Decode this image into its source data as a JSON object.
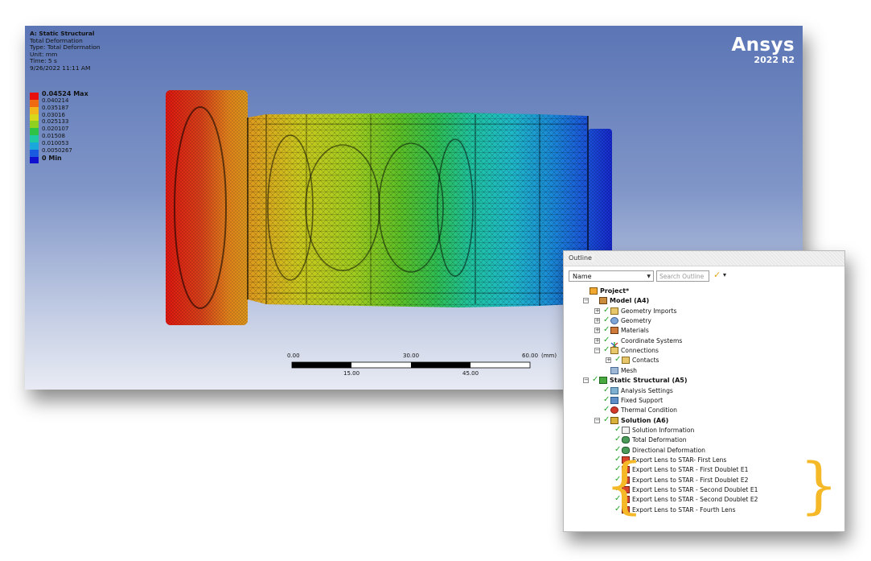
{
  "viewport": {
    "analysis_title": "A: Static Structural",
    "result_name": "Total Deformation",
    "result_type": "Type: Total Deformation",
    "unit": "Unit: mm",
    "time": "Time: 5 s",
    "timestamp": "9/26/2022 11:11 AM",
    "logo_brand": "Ansys",
    "logo_version": "2022 R2",
    "legend": [
      {
        "label": "0.04524 Max",
        "color": "#e8100c",
        "bold": true
      },
      {
        "label": "0.040214",
        "color": "#f06a12",
        "bold": false
      },
      {
        "label": "0.035187",
        "color": "#f2b51a",
        "bold": false
      },
      {
        "label": "0.03016",
        "color": "#d7d81c",
        "bold": false
      },
      {
        "label": "0.025133",
        "color": "#8fd021",
        "bold": false
      },
      {
        "label": "0.020107",
        "color": "#2fc345",
        "bold": false
      },
      {
        "label": "0.01508",
        "color": "#1fc9a3",
        "bold": false
      },
      {
        "label": "0.010053",
        "color": "#1aa7dc",
        "bold": false
      },
      {
        "label": "0.0050267",
        "color": "#1a5ae0",
        "bold": false
      },
      {
        "label": "0 Min",
        "color": "#1010d0",
        "bold": true
      }
    ],
    "scale_bar": {
      "top_labels": [
        "0.00",
        "30.00",
        "60.00"
      ],
      "bottom_labels": [
        "15.00",
        "45.00"
      ],
      "unit": "(mm)"
    }
  },
  "outline": {
    "title": "Outline",
    "filter_select": "Name",
    "search_placeholder": "Search Outline",
    "tree": [
      {
        "label": "Project*",
        "bold": true,
        "indent": 0,
        "expander": "",
        "check": false,
        "icon": "ic-project",
        "icon_name": "project-icon"
      },
      {
        "label": "Model (A4)",
        "bold": true,
        "indent": 1,
        "expander": "−",
        "check": false,
        "icon": "ic-model",
        "icon_name": "model-icon"
      },
      {
        "label": "Geometry Imports",
        "bold": false,
        "indent": 2,
        "expander": "+",
        "check": true,
        "icon": "ic-folder",
        "icon_name": "geometry-imports-icon"
      },
      {
        "label": "Geometry",
        "bold": false,
        "indent": 2,
        "expander": "+",
        "check": true,
        "icon": "ic-geom",
        "icon_name": "geometry-icon"
      },
      {
        "label": "Materials",
        "bold": false,
        "indent": 2,
        "expander": "+",
        "check": true,
        "icon": "ic-mat",
        "icon_name": "materials-icon"
      },
      {
        "label": "Coordinate Systems",
        "bold": false,
        "indent": 2,
        "expander": "+",
        "check": true,
        "icon": "ic-coord",
        "icon_name": "coordinate-systems-icon"
      },
      {
        "label": "Connections",
        "bold": false,
        "indent": 2,
        "expander": "−",
        "check": true,
        "icon": "ic-folder",
        "icon_name": "connections-icon"
      },
      {
        "label": "Contacts",
        "bold": false,
        "indent": 3,
        "expander": "+",
        "check": true,
        "icon": "ic-folder",
        "icon_name": "contacts-icon"
      },
      {
        "label": "Mesh",
        "bold": false,
        "indent": 2,
        "expander": "",
        "check": false,
        "icon": "ic-mesh",
        "icon_name": "mesh-icon"
      },
      {
        "label": "Static Structural (A5)",
        "bold": true,
        "indent": 1,
        "expander": "−",
        "check": true,
        "icon": "ic-static",
        "icon_name": "static-structural-icon"
      },
      {
        "label": "Analysis Settings",
        "bold": false,
        "indent": 2,
        "expander": "",
        "check": true,
        "icon": "ic-settings",
        "icon_name": "analysis-settings-icon"
      },
      {
        "label": "Fixed Support",
        "bold": false,
        "indent": 2,
        "expander": "",
        "check": true,
        "icon": "ic-support",
        "icon_name": "fixed-support-icon"
      },
      {
        "label": "Thermal Condition",
        "bold": false,
        "indent": 2,
        "expander": "",
        "check": true,
        "icon": "ic-thermal",
        "icon_name": "thermal-condition-icon"
      },
      {
        "label": "Solution (A6)",
        "bold": true,
        "indent": 2,
        "expander": "−",
        "check": true,
        "icon": "ic-solution",
        "icon_name": "solution-icon"
      },
      {
        "label": "Solution Information",
        "bold": false,
        "indent": 3,
        "expander": "",
        "check": true,
        "icon": "ic-info",
        "icon_name": "solution-information-icon"
      },
      {
        "label": "Total Deformation",
        "bold": false,
        "indent": 3,
        "expander": "",
        "check": true,
        "icon": "ic-deform",
        "icon_name": "total-deformation-icon"
      },
      {
        "label": "Directional Deformation",
        "bold": false,
        "indent": 3,
        "expander": "",
        "check": true,
        "icon": "ic-deform",
        "icon_name": "directional-deformation-icon"
      },
      {
        "label": "Export Lens to STAR- First Lens",
        "bold": false,
        "indent": 3,
        "expander": "",
        "check": true,
        "icon": "ic-py",
        "icon_name": "python-result-icon"
      },
      {
        "label": "Export Lens to STAR - First Doublet E1",
        "bold": false,
        "indent": 3,
        "expander": "",
        "check": true,
        "icon": "ic-py",
        "icon_name": "python-result-icon"
      },
      {
        "label": "Export Lens to STAR - First Doublet E2",
        "bold": false,
        "indent": 3,
        "expander": "",
        "check": true,
        "icon": "ic-py",
        "icon_name": "python-result-icon"
      },
      {
        "label": "Export Lens to STAR - Second Doublet E1",
        "bold": false,
        "indent": 3,
        "expander": "",
        "check": true,
        "icon": "ic-py",
        "icon_name": "python-result-icon"
      },
      {
        "label": "Export Lens to STAR - Second Doublet E2",
        "bold": false,
        "indent": 3,
        "expander": "",
        "check": true,
        "icon": "ic-py",
        "icon_name": "python-result-icon"
      },
      {
        "label": "Export Lens to STAR - Fourth Lens",
        "bold": false,
        "indent": 3,
        "expander": "",
        "check": true,
        "icon": "ic-py",
        "icon_name": "python-result-icon"
      }
    ]
  },
  "brace": {
    "left": "{",
    "right": "}",
    "color": "#f5b827"
  }
}
